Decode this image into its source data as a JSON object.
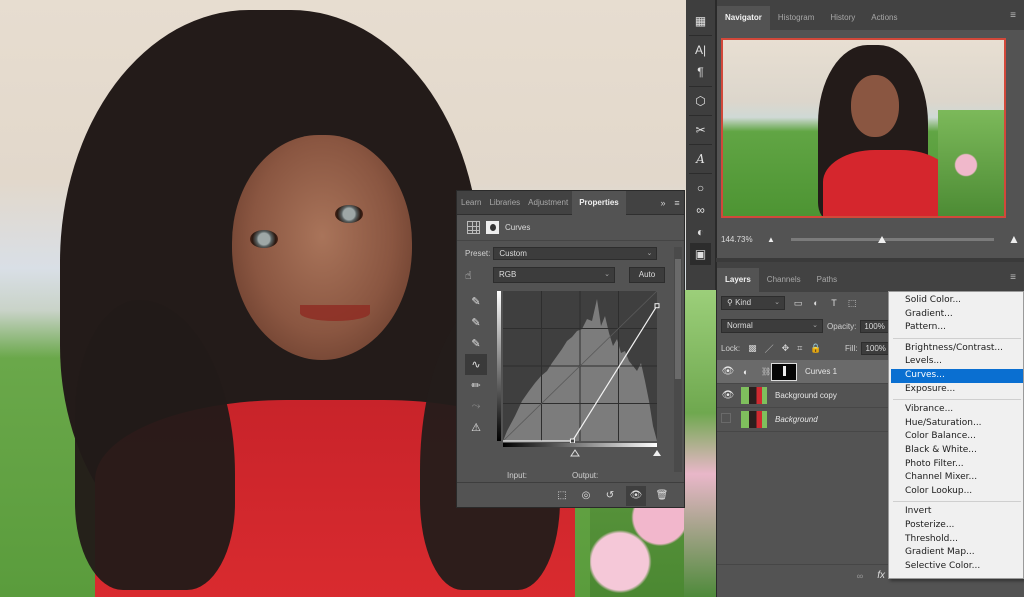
{
  "canvas": {
    "subject": "portrait photo of a girl in a red dress with long dark hair, green grass and pink flowers background"
  },
  "properties": {
    "tabs": [
      {
        "label": "Learn",
        "active": false
      },
      {
        "label": "Libraries",
        "active": false
      },
      {
        "label": "Adjustment",
        "active": false
      },
      {
        "label": "Properties",
        "active": true
      }
    ],
    "expand_icon": "»",
    "menu_icon": "≡",
    "title": "Curves",
    "preset_label": "Preset:",
    "preset_value": "Custom",
    "channel_value": "RGB",
    "auto_label": "Auto",
    "input_label": "Input:",
    "output_label": "Output:",
    "curve": {
      "points": [
        [
          0,
          0
        ],
        [
          115,
          0
        ],
        [
          255,
          230
        ]
      ],
      "note": "points in 0-255 levels: black point moved to ~115 input; white endpoint at 255 input / ~230 output"
    },
    "tools": [
      "sample-shadows-eyedropper",
      "sample-midtones-eyedropper",
      "sample-highlights-eyedropper",
      "curve-edit-tool",
      "pencil-tool",
      "smooth-tool",
      "clipping-warning-tool"
    ],
    "footer_buttons": [
      "clip-to-layer",
      "view-previous-state",
      "reset",
      "toggle-visibility",
      "delete"
    ]
  },
  "toolstrip": {
    "items": [
      "grid-icon",
      "character-icon",
      "paragraph-icon",
      "3d-icon",
      "tools-icon",
      "glyphs-icon",
      "lightbulb-icon",
      "creative-cloud-icon",
      "adjustments-icon",
      "properties-icon"
    ]
  },
  "navigator": {
    "tabs": [
      {
        "label": "Navigator",
        "active": true
      },
      {
        "label": "Histogram",
        "active": false
      },
      {
        "label": "History",
        "active": false
      },
      {
        "label": "Actions",
        "active": false
      }
    ],
    "zoom": "144.73%",
    "zoom_slider_fraction": 0.45
  },
  "layers": {
    "tabs": [
      {
        "label": "Layers",
        "active": true
      },
      {
        "label": "Channels",
        "active": false
      },
      {
        "label": "Paths",
        "active": false
      }
    ],
    "filter_kind": "Kind",
    "blend_mode": "Normal",
    "opacity_label": "Opacity:",
    "opacity_value": "100%",
    "lock_label": "Lock:",
    "fill_label": "Fill:",
    "fill_value": "100%",
    "items": [
      {
        "name": "Curves 1",
        "visible": true,
        "selected": true,
        "type": "adjustment"
      },
      {
        "name": "Background copy",
        "visible": true,
        "selected": false,
        "type": "pixel"
      },
      {
        "name": "Background",
        "visible": false,
        "selected": false,
        "type": "pixel-locked"
      }
    ]
  },
  "adjustment_menu": {
    "groups": [
      [
        "Solid Color...",
        "Gradient...",
        "Pattern..."
      ],
      [
        "Brightness/Contrast...",
        "Levels...",
        "Curves...",
        "Exposure..."
      ],
      [
        "Vibrance...",
        "Hue/Saturation...",
        "Color Balance...",
        "Black & White...",
        "Photo Filter...",
        "Channel Mixer...",
        "Color Lookup..."
      ],
      [
        "Invert",
        "Posterize...",
        "Threshold...",
        "Gradient Map...",
        "Selective Color..."
      ]
    ],
    "highlighted": "Curves...",
    "highlight_color": "#0a6fd1"
  }
}
